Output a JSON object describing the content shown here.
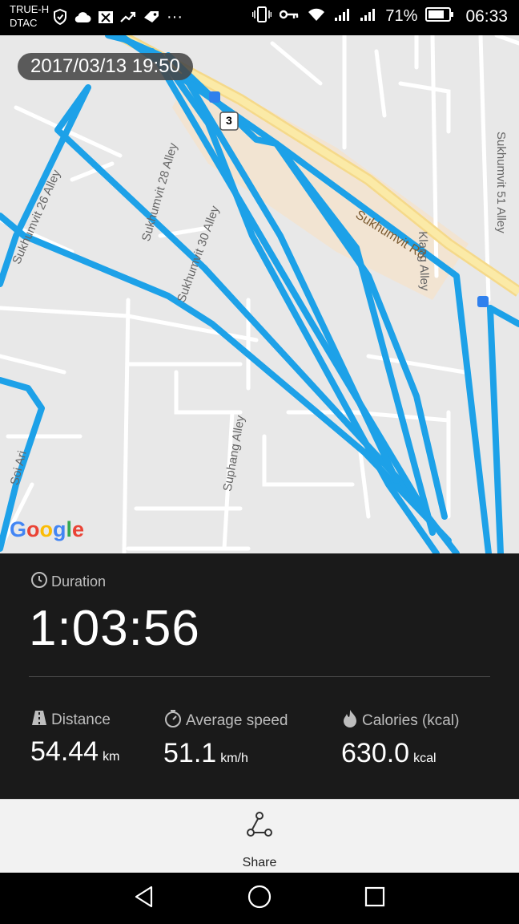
{
  "status_bar": {
    "carrier_line1": "TRUE-H",
    "carrier_line2": "DTAC",
    "battery": "71%",
    "time": "06:33"
  },
  "map": {
    "date_time": "2017/03/13 19:50",
    "route_color": "#1da1e8",
    "highway_number": "3",
    "streets": [
      "Sukhumvit 26 Alley",
      "Sukhumvit 28 Alley",
      "Sukhumvit 30 Alley",
      "Sukhumvit Rd",
      "Klang Alley",
      "Sukhumvit 51 Alley",
      "Suphang Alley",
      "Soi Ari"
    ],
    "attribution": "Google"
  },
  "stats": {
    "duration_label": "Duration",
    "duration_value": "1:03:56",
    "distance_label": "Distance",
    "distance_value": "54.44",
    "distance_unit": "km",
    "speed_label": "Average speed",
    "speed_value": "51.1",
    "speed_unit": "km/h",
    "calories_label": "Calories (kcal)",
    "calories_value": "630.0",
    "calories_unit": "kcal"
  },
  "share": {
    "label": "Share"
  },
  "nav": {
    "back_icon": "back-triangle-icon",
    "home_icon": "home-circle-icon",
    "recents_icon": "recents-square-icon"
  }
}
